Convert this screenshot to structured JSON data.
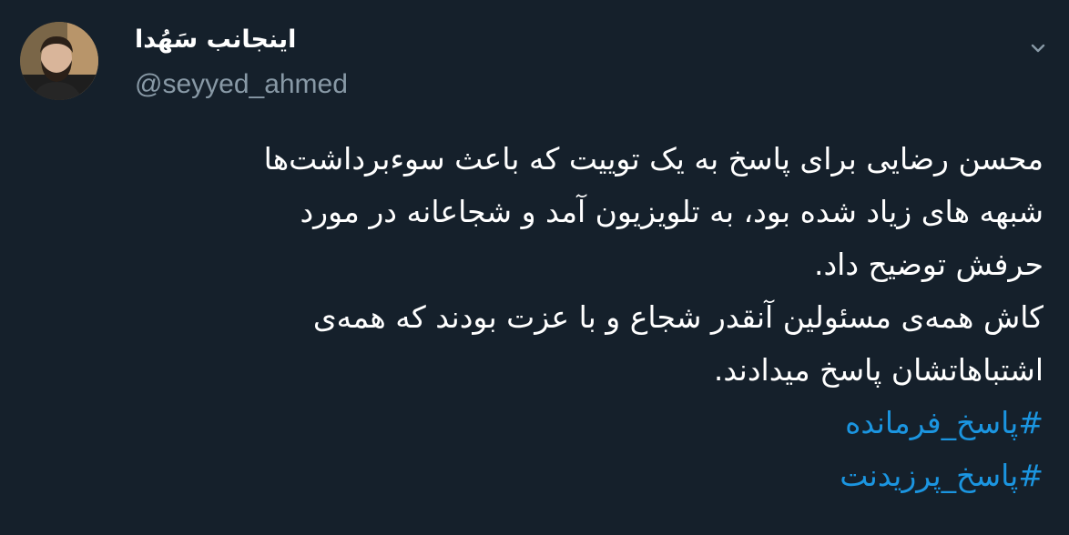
{
  "tweet": {
    "author": {
      "display_name": "اینجانب سَهُدا",
      "handle": "@seyyed_ahmed"
    },
    "menu_icon": "chevron-down-icon",
    "lines": [
      "محسن رضایی برای پاسخ به یک توییت که باعث سوءبرداشت‌ها",
      "شبهه های زیاد شده بود، به تلویزیون آمد و شجاعانه در مورد",
      "حرفش توضیح داد.",
      "کاش همه‌ی مسئولین آنقدر شجاع و با عزت بودند که همه‌ی",
      "اشتباهاتشان پاسخ میدادند."
    ],
    "hashtags": [
      "#پاسخ_فرمانده",
      "#پاسخ_پرزیدنت"
    ]
  },
  "colors": {
    "background": "#15202b",
    "text": "#ffffff",
    "secondary_text": "#8899a6",
    "link": "#1b95e0"
  }
}
